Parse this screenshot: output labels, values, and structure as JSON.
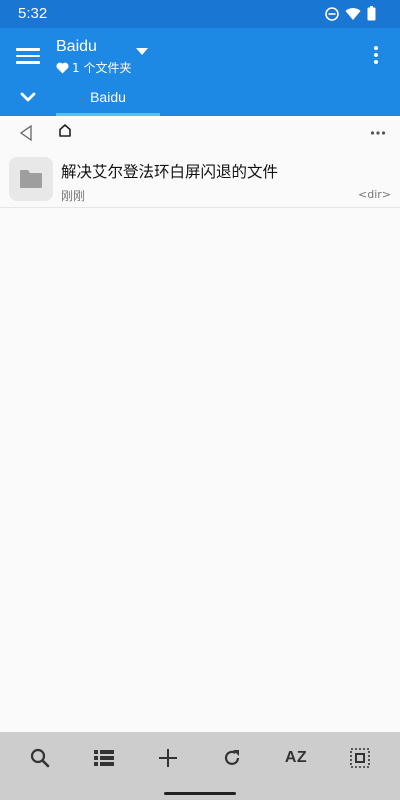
{
  "status_bar": {
    "time": "5:32"
  },
  "app_bar": {
    "title": "Baidu",
    "subtitle": "1 个文件夹",
    "tab_label": "Baidu"
  },
  "files": [
    {
      "name": "解决艾尔登法环白屏闪退的文件",
      "time": "刚刚",
      "type": "<dir>"
    }
  ],
  "bottom_bar": {
    "sort_label": "AZ"
  },
  "colors": {
    "status_bar": "#1976d2",
    "app_bar": "#1e88e5",
    "tab_indicator": "#4fc3f7",
    "bottom_bar": "#cdcdcd"
  },
  "icons": [
    "dnd-icon",
    "wifi-icon",
    "battery-icon",
    "menu-icon",
    "heart-icon",
    "dropdown-icon",
    "more-vert-icon",
    "chevron-down-icon",
    "back-icon",
    "home-icon",
    "more-horiz-icon",
    "folder-icon",
    "search-icon",
    "list-view-icon",
    "add-icon",
    "refresh-icon",
    "select-all-icon"
  ]
}
